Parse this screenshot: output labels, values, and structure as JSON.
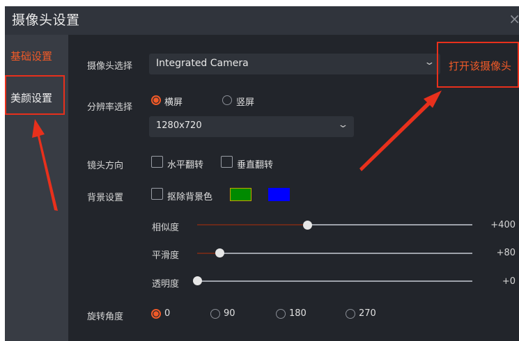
{
  "window": {
    "title": "摄像头设置",
    "close_glyph": "×"
  },
  "sidebar": {
    "items": [
      {
        "label": "基础设置",
        "active": true
      },
      {
        "label": "美颜设置",
        "active": false
      }
    ]
  },
  "camera": {
    "label": "摄像头选择",
    "selected": "Integrated Camera",
    "open_button": "打开该摄像头"
  },
  "resolution": {
    "label": "分辨率选择",
    "orientation_options": [
      {
        "label": "横屏",
        "selected": true
      },
      {
        "label": "竖屏",
        "selected": false
      }
    ],
    "selected": "1280x720"
  },
  "lens": {
    "label": "镜头方向",
    "options": [
      {
        "label": "水平翻转",
        "checked": false
      },
      {
        "label": "垂直翻转",
        "checked": false
      }
    ]
  },
  "background": {
    "label": "背景设置",
    "remove_label": "抠除背景色",
    "remove_checked": false,
    "colors": [
      "#008a00",
      "#0000ff"
    ],
    "sliders": [
      {
        "label": "相似度",
        "value": "+400",
        "fraction": 0.4
      },
      {
        "label": "平滑度",
        "value": "+80",
        "fraction": 0.08
      },
      {
        "label": "透明度",
        "value": "+0",
        "fraction": 0.0
      }
    ]
  },
  "rotation": {
    "label": "旋转角度",
    "options": [
      {
        "label": "0",
        "selected": true
      },
      {
        "label": "90",
        "selected": false
      },
      {
        "label": "180",
        "selected": false
      },
      {
        "label": "270",
        "selected": false
      }
    ]
  },
  "colors": {
    "accent": "#f05a28",
    "annotation": "#e8301c"
  }
}
